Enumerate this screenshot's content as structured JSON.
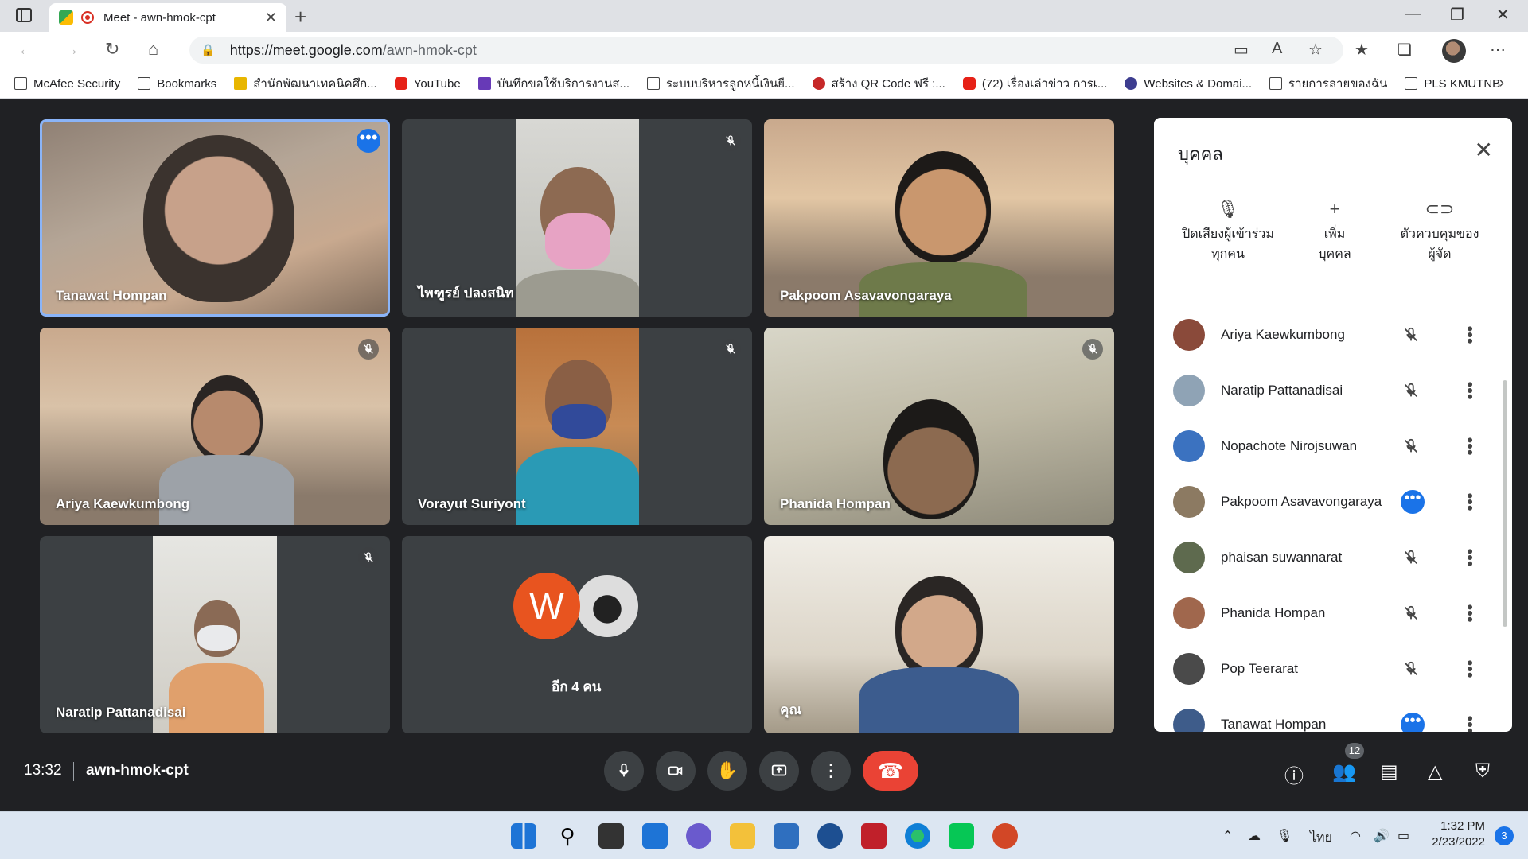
{
  "browser": {
    "tab_title": "Meet - awn-hmok-cpt",
    "url_host": "https://meet.google.com",
    "url_path": "/awn-hmok-cpt"
  },
  "bookmarks": [
    "McAfee Security",
    "Bookmarks",
    "สำนักพัฒนาเทคนิคศึก...",
    "YouTube",
    "บันทึกขอใช้บริการงานส...",
    "ระบบบริหารลูกหนี้เงินยื...",
    "สร้าง QR Code ฟรี :...",
    "(72) เรื่องเล่าข่าว การเ...",
    "Websites & Domai...",
    "รายการลายของฉัน",
    "PLS KMUTNB"
  ],
  "tiles": [
    {
      "name": "Tanawat Hompan"
    },
    {
      "name": "ไพฑูรย์ ปลงสนิท"
    },
    {
      "name": "Pakpoom Asavavongaraya"
    },
    {
      "name": "Ariya Kaewkumbong"
    },
    {
      "name": "Vorayut Suriyont"
    },
    {
      "name": "Phanida Hompan"
    },
    {
      "name": "Naratip Pattanadisai"
    },
    {
      "name": "อีก 4 คน",
      "avatar_letter": "W"
    },
    {
      "name": "คุณ"
    }
  ],
  "panel": {
    "title": "บุคคล",
    "actions": [
      {
        "label1": "ปิดเสียงผู้เข้าร่วม",
        "label2": "ทุกคน",
        "icon": "mic-off-icon"
      },
      {
        "label1": "เพิ่ม",
        "label2": "บุคคล",
        "icon": "person-add-icon"
      },
      {
        "label1": "ตัวควบคุมของ",
        "label2": "ผู้จัด",
        "icon": "toggle-icon"
      }
    ],
    "people": [
      {
        "name": "Ariya Kaewkumbong",
        "state": "muted"
      },
      {
        "name": "Naratip Pattanadisai",
        "state": "muted"
      },
      {
        "name": "Nopachote Nirojsuwan",
        "state": "muted"
      },
      {
        "name": "Pakpoom Asavavongaraya",
        "state": "speaking"
      },
      {
        "name": "phaisan suwannarat",
        "state": "muted"
      },
      {
        "name": "Phanida Hompan",
        "state": "muted"
      },
      {
        "name": "Pop Teerarat",
        "state": "muted"
      },
      {
        "name": "Tanawat Hompan",
        "state": "speaking"
      }
    ]
  },
  "bottom": {
    "time": "13:32",
    "meeting_code": "awn-hmok-cpt",
    "participant_count": "12"
  },
  "taskbar": {
    "time": "1:32 PM",
    "date": "2/23/2022",
    "lang": "ไทย",
    "notifications": "3"
  },
  "colors": {
    "meet_bg": "#202124",
    "tile_bg": "#3c4043",
    "accent": "#1a73e8",
    "end_call": "#ea4335"
  }
}
